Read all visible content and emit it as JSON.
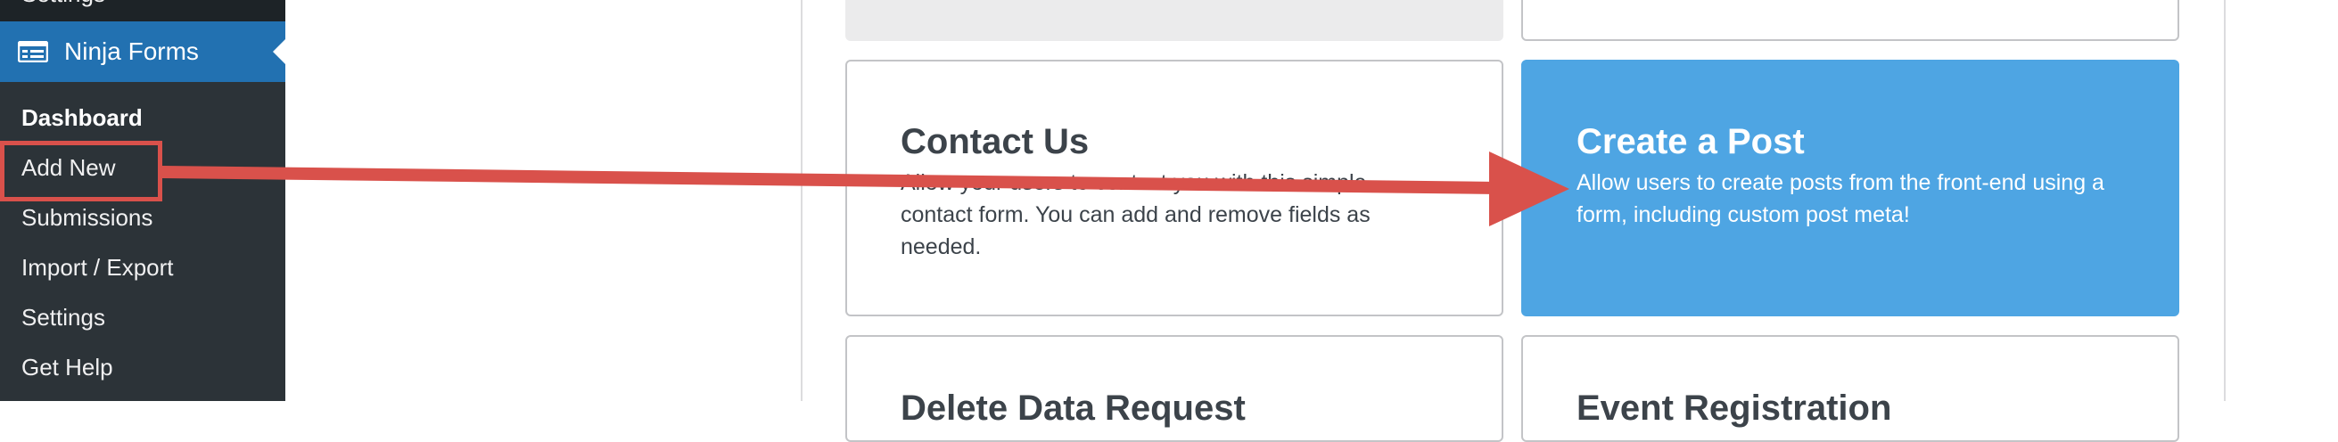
{
  "sidebar": {
    "prev_item_label": "Settings",
    "menu": {
      "label": "Ninja Forms",
      "icon": "ninja-forms-icon"
    },
    "submenu": [
      {
        "label": "Dashboard",
        "current": true
      },
      {
        "label": "Add New"
      },
      {
        "label": "Submissions"
      },
      {
        "label": "Import / Export"
      },
      {
        "label": "Settings"
      },
      {
        "label": "Get Help"
      }
    ]
  },
  "cards": {
    "contact_us": {
      "title": "Contact Us",
      "desc": "Allow your users to contact you with this simple contact form. You can add and remove fields as needed."
    },
    "create_post": {
      "title": "Create a Post",
      "desc": "Allow users to create posts from the front-end using a form, including custom post meta!"
    },
    "bottom_left": {
      "title": "Delete Data Request"
    },
    "bottom_right": {
      "title": "Event Registration"
    }
  },
  "colors": {
    "sidebar_bg": "#2c3338",
    "menu_active": "#2271b1",
    "card_blue": "#4ea5e3",
    "annotation_red": "#d9514b"
  },
  "annotation": {
    "from": "sidebar-add-new",
    "to": "create-a-post-card",
    "icon": "arrow-right-icon"
  }
}
